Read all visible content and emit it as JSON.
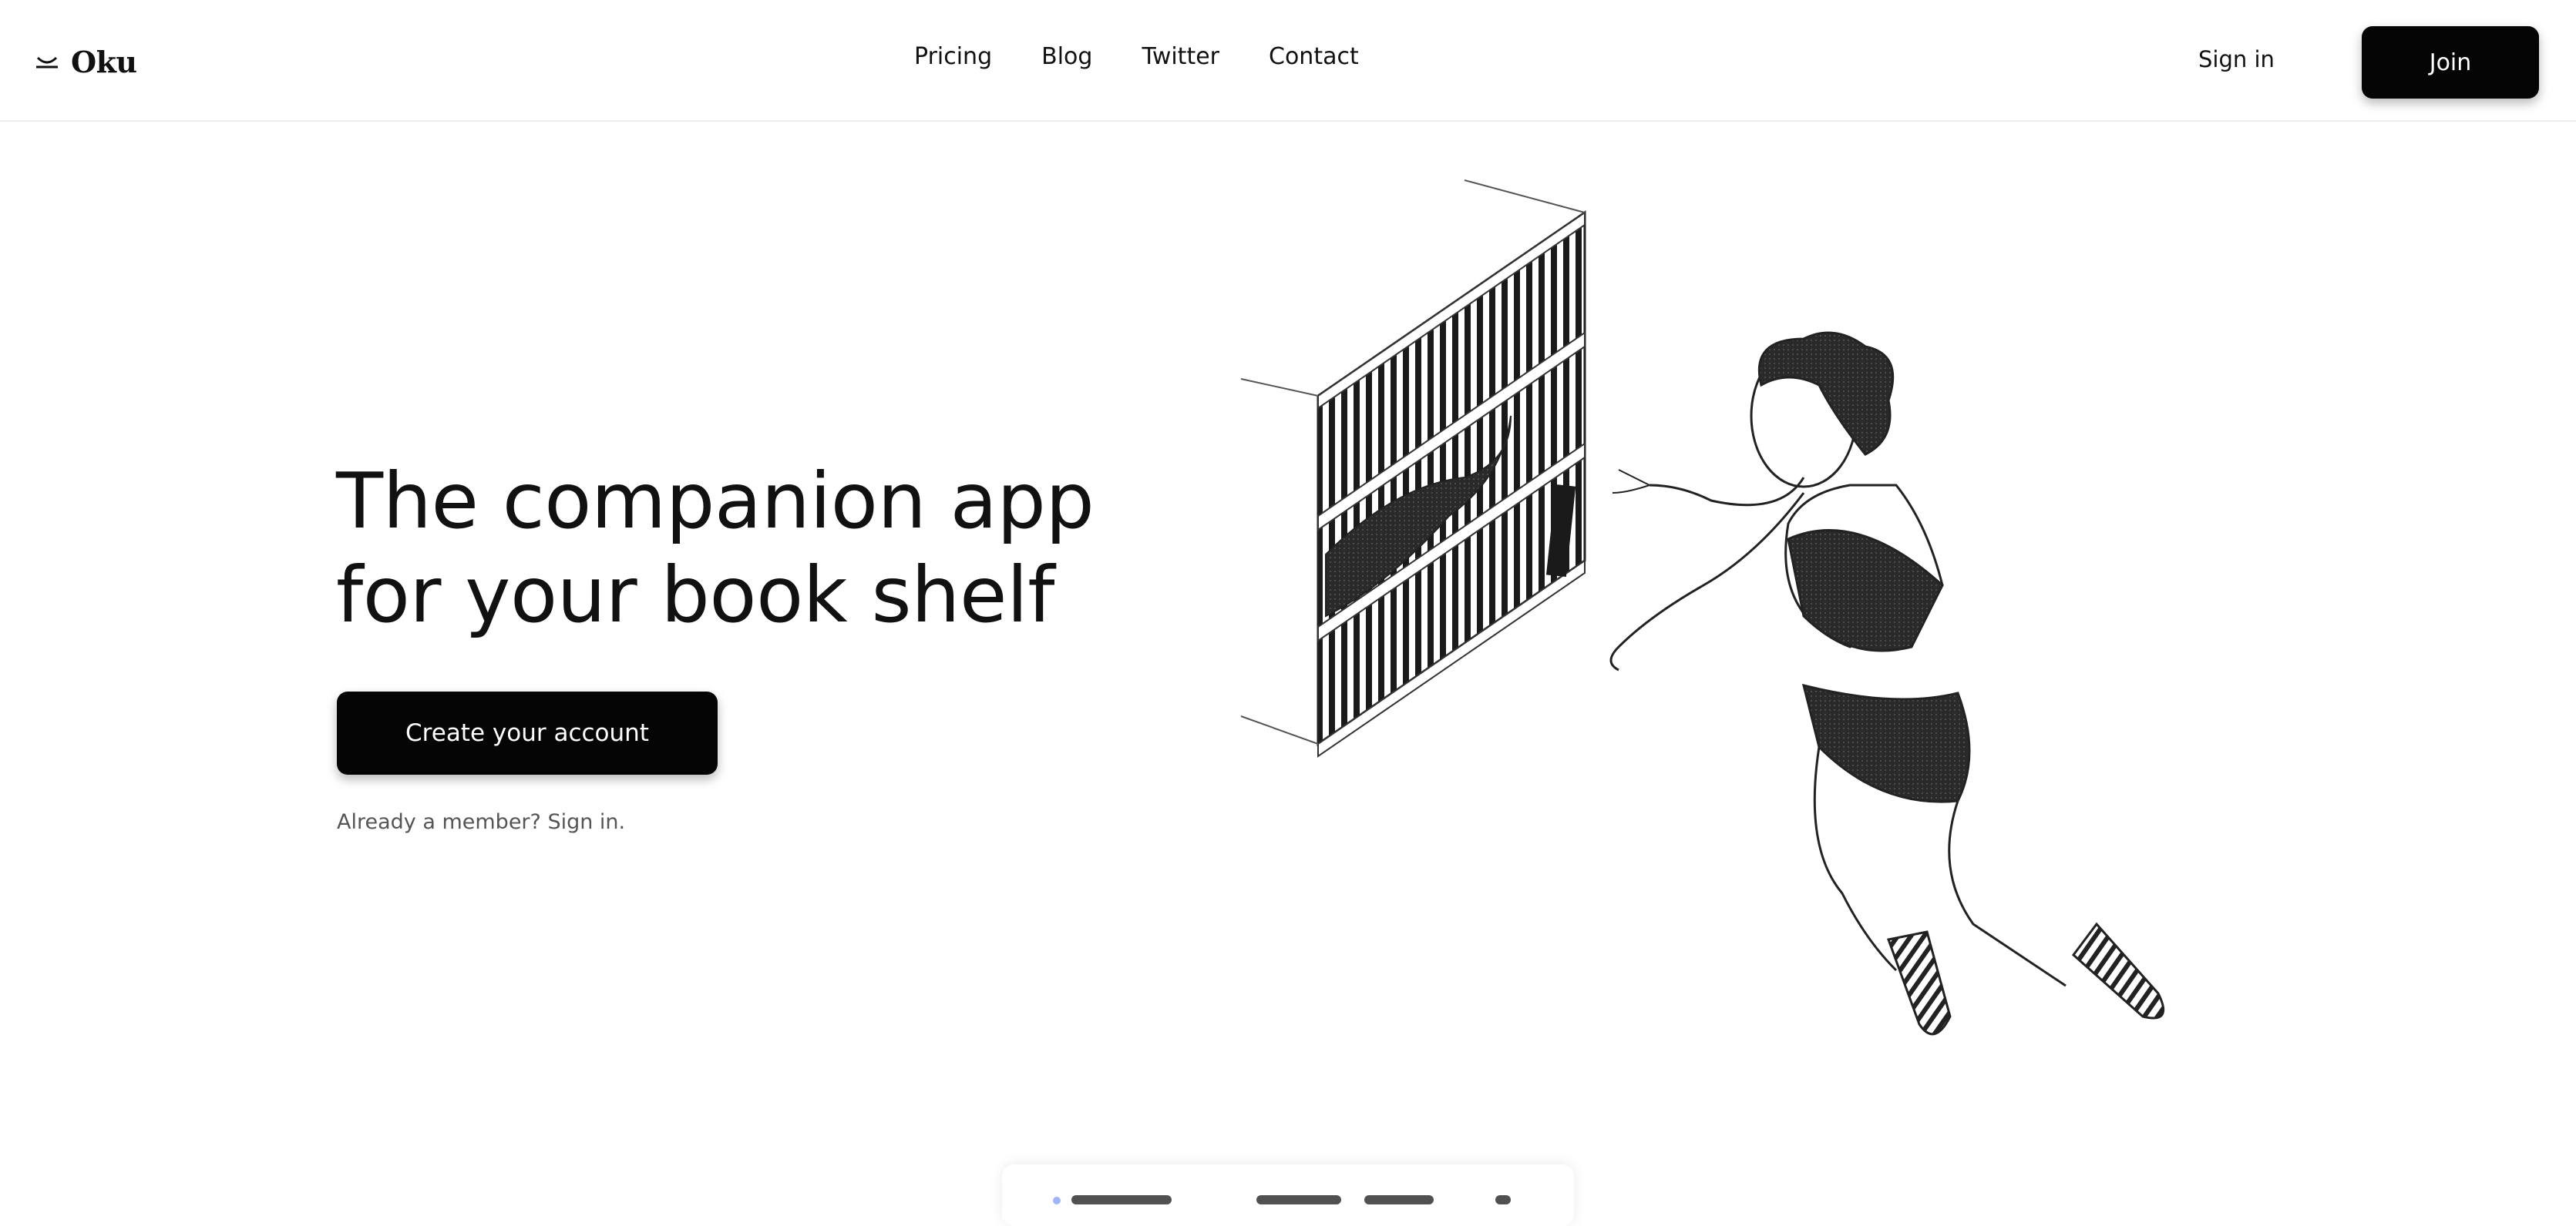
{
  "brand": {
    "name": "Oku",
    "icon": "oku-logo-icon"
  },
  "nav": {
    "items": [
      {
        "label": "Pricing"
      },
      {
        "label": "Blog"
      },
      {
        "label": "Twitter"
      },
      {
        "label": "Contact"
      }
    ],
    "sign_in_label": "Sign in",
    "join_label": "Join"
  },
  "hero": {
    "title_line1": "The companion app",
    "title_line2": "for your book shelf",
    "cta_label": "Create your account",
    "member_text": "Already a member? Sign in."
  },
  "colors": {
    "button_bg": "#050505",
    "button_text": "#ffffff",
    "text": "#111111",
    "muted": "#555555"
  }
}
